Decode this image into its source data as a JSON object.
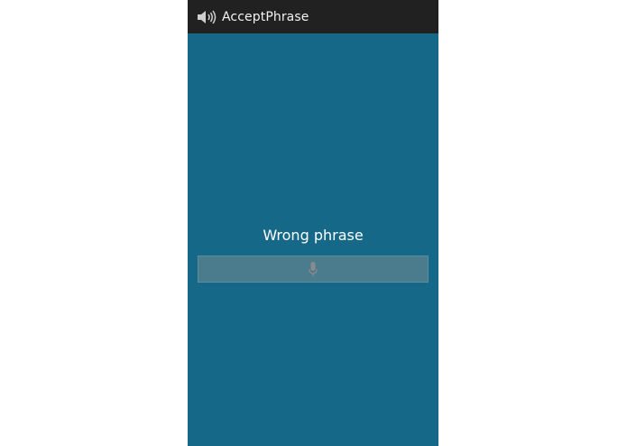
{
  "app": {
    "title": "AcceptPhrase",
    "icon": "speaker-icon"
  },
  "main": {
    "status_text": "Wrong phrase",
    "mic_button_icon": "microphone-icon"
  },
  "colors": {
    "action_bar": "#212121",
    "background": "#156888",
    "button": "#4a7c8e"
  }
}
